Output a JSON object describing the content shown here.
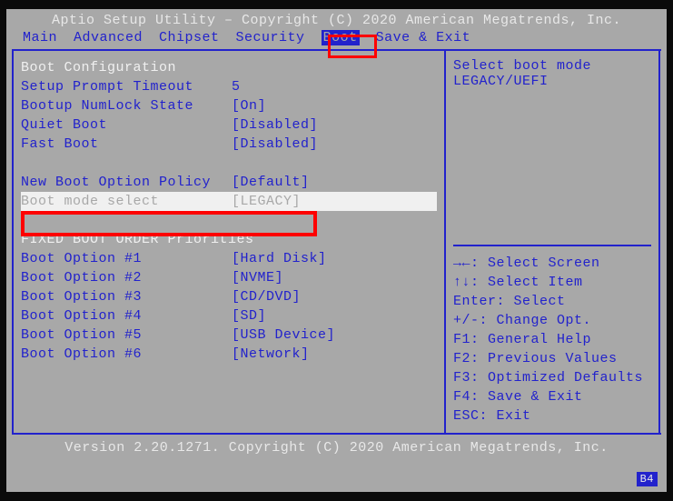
{
  "header": "Aptio Setup Utility – Copyright (C) 2020 American Megatrends, Inc.",
  "menu": {
    "items": [
      "Main",
      "Advanced",
      "Chipset",
      "Security",
      "Boot",
      "Save & Exit"
    ],
    "active_index": 4
  },
  "left": {
    "section1_title": "Boot Configuration",
    "rows1": [
      {
        "label": "Setup Prompt Timeout",
        "value": "5"
      },
      {
        "label": "Bootup NumLock State",
        "value": "[On]"
      },
      {
        "label": "Quiet Boot",
        "value": "[Disabled]"
      },
      {
        "label": "Fast Boot",
        "value": "[Disabled]"
      }
    ],
    "rows2": [
      {
        "label": "New Boot Option Policy",
        "value": "[Default]"
      }
    ],
    "selected": {
      "label": "Boot mode select",
      "value": "[LEGACY]"
    },
    "section2_title": "FIXED BOOT ORDER Priorities",
    "boot_options": [
      {
        "label": "Boot Option #1",
        "value": "[Hard Disk]"
      },
      {
        "label": "Boot Option #2",
        "value": "[NVME]"
      },
      {
        "label": "Boot Option #3",
        "value": "[CD/DVD]"
      },
      {
        "label": "Boot Option #4",
        "value": "[SD]"
      },
      {
        "label": "Boot Option #5",
        "value": "[USB Device]"
      },
      {
        "label": "Boot Option #6",
        "value": "[Network]"
      }
    ]
  },
  "right": {
    "desc_line1": "Select boot mode",
    "desc_line2": "LEGACY/UEFI",
    "help": [
      "→←: Select Screen",
      "↑↓: Select Item",
      "Enter: Select",
      "+/-: Change Opt.",
      "F1: General Help",
      "F2: Previous Values",
      "F3: Optimized Defaults",
      "F4: Save & Exit",
      "ESC: Exit"
    ]
  },
  "footer": "Version 2.20.1271. Copyright (C) 2020 American Megatrends, Inc.",
  "badge": "B4"
}
